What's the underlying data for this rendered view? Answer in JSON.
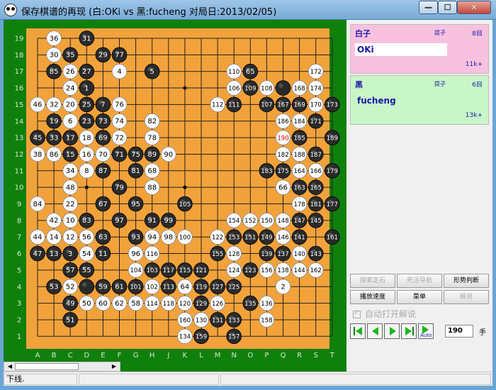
{
  "window": {
    "title": "保存棋谱的再现 (白:OKi vs 黑:fucheng  对局日:2013/02/05)",
    "min_glyph": "—",
    "max_glyph": "☐",
    "close_glyph": "✕"
  },
  "board": {
    "columns": [
      "A",
      "B",
      "C",
      "D",
      "E",
      "F",
      "G",
      "H",
      "J",
      "K",
      "L",
      "M",
      "N",
      "O",
      "P",
      "Q",
      "R",
      "S",
      "T"
    ],
    "rows": [
      "19",
      "18",
      "17",
      "16",
      "15",
      "14",
      "13",
      "12",
      "11",
      "10",
      "9",
      "8",
      "7",
      "6",
      "5",
      "4",
      "3",
      "2",
      "1"
    ],
    "highlight_number_color": "#dd0000",
    "stones": [
      {
        "c": "B",
        "r": 19,
        "n": "36"
      },
      {
        "c": "D",
        "r": 19,
        "n": "31"
      },
      {
        "c": "B",
        "r": 18,
        "n": "30"
      },
      {
        "c": "C",
        "r": 18,
        "n": "35"
      },
      {
        "c": "E",
        "r": 18,
        "n": "29"
      },
      {
        "c": "F",
        "r": 18,
        "n": "77"
      },
      {
        "c": "B",
        "r": 17,
        "n": "85"
      },
      {
        "c": "C",
        "r": 17,
        "n": "26"
      },
      {
        "c": "D",
        "r": 17,
        "n": "27"
      },
      {
        "c": "F",
        "r": 17,
        "n": "4"
      },
      {
        "c": "H",
        "r": 17,
        "n": "5"
      },
      {
        "c": "N",
        "r": 17,
        "n": "110"
      },
      {
        "c": "O",
        "r": 17,
        "n": "65"
      },
      {
        "c": "S",
        "r": 17,
        "n": "172"
      },
      {
        "c": "C",
        "r": 16,
        "n": "24"
      },
      {
        "c": "D",
        "r": 16,
        "n": "1"
      },
      {
        "c": "N",
        "r": 16,
        "n": "106"
      },
      {
        "c": "O",
        "r": 16,
        "n": "109"
      },
      {
        "c": "P",
        "r": 16,
        "n": "108"
      },
      {
        "c": "Q",
        "r": 16,
        "n": ""
      },
      {
        "c": "R",
        "r": 16,
        "n": "168"
      },
      {
        "c": "S",
        "r": 16,
        "n": "174"
      },
      {
        "c": "A",
        "r": 15,
        "n": "46"
      },
      {
        "c": "B",
        "r": 15,
        "n": "32"
      },
      {
        "c": "C",
        "r": 15,
        "n": "20"
      },
      {
        "c": "D",
        "r": 15,
        "n": "25"
      },
      {
        "c": "E",
        "r": 15,
        "n": "7"
      },
      {
        "c": "F",
        "r": 15,
        "n": "76"
      },
      {
        "c": "M",
        "r": 15,
        "n": "112"
      },
      {
        "c": "N",
        "r": 15,
        "n": "111"
      },
      {
        "c": "P",
        "r": 15,
        "n": "107"
      },
      {
        "c": "Q",
        "r": 15,
        "n": "167"
      },
      {
        "c": "R",
        "r": 15,
        "n": "169"
      },
      {
        "c": "S",
        "r": 15,
        "n": "170"
      },
      {
        "c": "T",
        "r": 15,
        "n": "173"
      },
      {
        "c": "B",
        "r": 14,
        "n": "19"
      },
      {
        "c": "C",
        "r": 14,
        "n": "6"
      },
      {
        "c": "D",
        "r": 14,
        "n": "23"
      },
      {
        "c": "E",
        "r": 14,
        "n": "73"
      },
      {
        "c": "F",
        "r": 14,
        "n": "74"
      },
      {
        "c": "H",
        "r": 14,
        "n": "82"
      },
      {
        "c": "Q",
        "r": 14,
        "n": "186"
      },
      {
        "c": "R",
        "r": 14,
        "n": "184"
      },
      {
        "c": "S",
        "r": 14,
        "n": "171"
      },
      {
        "c": "A",
        "r": 13,
        "n": "45"
      },
      {
        "c": "B",
        "r": 13,
        "n": "33"
      },
      {
        "c": "C",
        "r": 13,
        "n": "17"
      },
      {
        "c": "D",
        "r": 13,
        "n": "18"
      },
      {
        "c": "E",
        "r": 13,
        "n": "69"
      },
      {
        "c": "F",
        "r": 13,
        "n": "72"
      },
      {
        "c": "H",
        "r": 13,
        "n": "78"
      },
      {
        "c": "Q",
        "r": 13,
        "n": "190"
      },
      {
        "c": "R",
        "r": 13,
        "n": "185"
      },
      {
        "c": "T",
        "r": 13,
        "n": "189"
      },
      {
        "c": "A",
        "r": 12,
        "n": "38"
      },
      {
        "c": "B",
        "r": 12,
        "n": "86"
      },
      {
        "c": "C",
        "r": 12,
        "n": "15"
      },
      {
        "c": "D",
        "r": 12,
        "n": "16"
      },
      {
        "c": "E",
        "r": 12,
        "n": "70"
      },
      {
        "c": "F",
        "r": 12,
        "n": "71"
      },
      {
        "c": "G",
        "r": 12,
        "n": "75"
      },
      {
        "c": "H",
        "r": 12,
        "n": "89"
      },
      {
        "c": "J",
        "r": 12,
        "n": "90"
      },
      {
        "c": "Q",
        "r": 12,
        "n": "182"
      },
      {
        "c": "R",
        "r": 12,
        "n": "188"
      },
      {
        "c": "S",
        "r": 12,
        "n": "187"
      },
      {
        "c": "C",
        "r": 11,
        "n": "34"
      },
      {
        "c": "D",
        "r": 11,
        "n": "8"
      },
      {
        "c": "E",
        "r": 11,
        "n": "87"
      },
      {
        "c": "G",
        "r": 11,
        "n": "81"
      },
      {
        "c": "H",
        "r": 11,
        "n": "68"
      },
      {
        "c": "P",
        "r": 11,
        "n": "183"
      },
      {
        "c": "Q",
        "r": 11,
        "n": "175"
      },
      {
        "c": "R",
        "r": 11,
        "n": "164"
      },
      {
        "c": "S",
        "r": 11,
        "n": "166"
      },
      {
        "c": "T",
        "r": 11,
        "n": "179"
      },
      {
        "c": "C",
        "r": 10,
        "n": "48"
      },
      {
        "c": "F",
        "r": 10,
        "n": "79"
      },
      {
        "c": "H",
        "r": 10,
        "n": "88"
      },
      {
        "c": "Q",
        "r": 10,
        "n": "66"
      },
      {
        "c": "R",
        "r": 10,
        "n": "163"
      },
      {
        "c": "S",
        "r": 10,
        "n": "165"
      },
      {
        "c": "A",
        "r": 9,
        "n": "84"
      },
      {
        "c": "C",
        "r": 9,
        "n": "22"
      },
      {
        "c": "E",
        "r": 9,
        "n": "67"
      },
      {
        "c": "G",
        "r": 9,
        "n": "95"
      },
      {
        "c": "K",
        "r": 9,
        "n": "105"
      },
      {
        "c": "R",
        "r": 9,
        "n": "178"
      },
      {
        "c": "S",
        "r": 9,
        "n": "181"
      },
      {
        "c": "T",
        "r": 9,
        "n": "177"
      },
      {
        "c": "B",
        "r": 8,
        "n": "42"
      },
      {
        "c": "C",
        "r": 8,
        "n": "10"
      },
      {
        "c": "D",
        "r": 8,
        "n": "83"
      },
      {
        "c": "F",
        "r": 8,
        "n": "97"
      },
      {
        "c": "H",
        "r": 8,
        "n": "91"
      },
      {
        "c": "J",
        "r": 8,
        "n": "99"
      },
      {
        "c": "N",
        "r": 8,
        "n": "154"
      },
      {
        "c": "O",
        "r": 8,
        "n": "152"
      },
      {
        "c": "P",
        "r": 8,
        "n": "150"
      },
      {
        "c": "Q",
        "r": 8,
        "n": "148"
      },
      {
        "c": "R",
        "r": 8,
        "n": "147"
      },
      {
        "c": "S",
        "r": 8,
        "n": "145"
      },
      {
        "c": "A",
        "r": 7,
        "n": "44"
      },
      {
        "c": "B",
        "r": 7,
        "n": "14"
      },
      {
        "c": "C",
        "r": 7,
        "n": "12"
      },
      {
        "c": "D",
        "r": 7,
        "n": "56"
      },
      {
        "c": "E",
        "r": 7,
        "n": "63"
      },
      {
        "c": "G",
        "r": 7,
        "n": "93"
      },
      {
        "c": "H",
        "r": 7,
        "n": "94"
      },
      {
        "c": "J",
        "r": 7,
        "n": "98"
      },
      {
        "c": "K",
        "r": 7,
        "n": "100"
      },
      {
        "c": "M",
        "r": 7,
        "n": "122"
      },
      {
        "c": "N",
        "r": 7,
        "n": "153"
      },
      {
        "c": "O",
        "r": 7,
        "n": "151"
      },
      {
        "c": "P",
        "r": 7,
        "n": "149"
      },
      {
        "c": "Q",
        "r": 7,
        "n": "146"
      },
      {
        "c": "R",
        "r": 7,
        "n": "141"
      },
      {
        "c": "T",
        "r": 7,
        "n": "161"
      },
      {
        "c": "A",
        "r": 6,
        "n": "47"
      },
      {
        "c": "B",
        "r": 6,
        "n": "13"
      },
      {
        "c": "C",
        "r": 6,
        "n": "3"
      },
      {
        "c": "D",
        "r": 6,
        "n": "54"
      },
      {
        "c": "E",
        "r": 6,
        "n": "11"
      },
      {
        "c": "G",
        "r": 6,
        "n": "96"
      },
      {
        "c": "H",
        "r": 6,
        "n": "116"
      },
      {
        "c": "M",
        "r": 6,
        "n": "155"
      },
      {
        "c": "N",
        "r": 6,
        "n": "128"
      },
      {
        "c": "P",
        "r": 6,
        "n": "139"
      },
      {
        "c": "Q",
        "r": 6,
        "n": "137"
      },
      {
        "c": "R",
        "r": 6,
        "n": "140"
      },
      {
        "c": "S",
        "r": 6,
        "n": "143"
      },
      {
        "c": "C",
        "r": 5,
        "n": "57"
      },
      {
        "c": "D",
        "r": 5,
        "n": "55"
      },
      {
        "c": "G",
        "r": 5,
        "n": "104"
      },
      {
        "c": "H",
        "r": 5,
        "n": "103"
      },
      {
        "c": "J",
        "r": 5,
        "n": "117"
      },
      {
        "c": "K",
        "r": 5,
        "n": "115"
      },
      {
        "c": "L",
        "r": 5,
        "n": "121"
      },
      {
        "c": "N",
        "r": 5,
        "n": "124"
      },
      {
        "c": "O",
        "r": 5,
        "n": "123"
      },
      {
        "c": "P",
        "r": 5,
        "n": "156"
      },
      {
        "c": "Q",
        "r": 5,
        "n": "138"
      },
      {
        "c": "R",
        "r": 5,
        "n": "144"
      },
      {
        "c": "S",
        "r": 5,
        "n": "162"
      },
      {
        "c": "B",
        "r": 4,
        "n": "53"
      },
      {
        "c": "C",
        "r": 4,
        "n": "52"
      },
      {
        "c": "D",
        "r": 4,
        "n": ""
      },
      {
        "c": "E",
        "r": 4,
        "n": "59"
      },
      {
        "c": "F",
        "r": 4,
        "n": "61"
      },
      {
        "c": "G",
        "r": 4,
        "n": "101"
      },
      {
        "c": "H",
        "r": 4,
        "n": "102"
      },
      {
        "c": "J",
        "r": 4,
        "n": "113"
      },
      {
        "c": "K",
        "r": 4,
        "n": "64"
      },
      {
        "c": "L",
        "r": 4,
        "n": "119"
      },
      {
        "c": "M",
        "r": 4,
        "n": "127"
      },
      {
        "c": "N",
        "r": 4,
        "n": "125"
      },
      {
        "c": "Q",
        "r": 4,
        "n": "2"
      },
      {
        "c": "C",
        "r": 3,
        "n": "49"
      },
      {
        "c": "D",
        "r": 3,
        "n": "50"
      },
      {
        "c": "E",
        "r": 3,
        "n": "60"
      },
      {
        "c": "F",
        "r": 3,
        "n": "62"
      },
      {
        "c": "G",
        "r": 3,
        "n": "58"
      },
      {
        "c": "H",
        "r": 3,
        "n": "114"
      },
      {
        "c": "J",
        "r": 3,
        "n": "118"
      },
      {
        "c": "K",
        "r": 3,
        "n": "120"
      },
      {
        "c": "L",
        "r": 3,
        "n": "129"
      },
      {
        "c": "M",
        "r": 3,
        "n": "126"
      },
      {
        "c": "O",
        "r": 3,
        "n": "135"
      },
      {
        "c": "P",
        "r": 3,
        "n": "136"
      },
      {
        "c": "C",
        "r": 2,
        "n": "51"
      },
      {
        "c": "K",
        "r": 2,
        "n": "160"
      },
      {
        "c": "L",
        "r": 2,
        "n": "130"
      },
      {
        "c": "M",
        "r": 2,
        "n": "131"
      },
      {
        "c": "N",
        "r": 2,
        "n": "133"
      },
      {
        "c": "P",
        "r": 2,
        "n": "158"
      },
      {
        "c": "K",
        "r": 1,
        "n": "134"
      },
      {
        "c": "L",
        "r": 1,
        "n": "159"
      },
      {
        "c": "N",
        "r": 1,
        "n": "157"
      }
    ]
  },
  "players": {
    "white": {
      "label": "白子",
      "captures_label": "提子",
      "captures": "8目",
      "name": "OKi",
      "rank": "11k+",
      "color": "#f8c2de"
    },
    "black": {
      "label": "黑",
      "captures_label": "提子",
      "captures": "6目",
      "name": "fucheng",
      "rank": "13k+",
      "color": "#c8f6c6"
    }
  },
  "buttons": {
    "search_joseki": "搜索定石",
    "life_death_nav": "死活导航",
    "position_judge": "形势判断",
    "play_speed": "播放速度",
    "menu": "菜单",
    "commentary": "解说"
  },
  "auto_commentary_label": "自动打开解说",
  "navigation": {
    "first_icon": "skip-to-start-icon",
    "prev_icon": "previous-icon",
    "next_icon": "next-icon",
    "last_icon": "skip-to-end-icon",
    "auto_label": "Auto",
    "move_number": "190",
    "move_suffix": "手"
  },
  "status": {
    "text": "下线."
  }
}
